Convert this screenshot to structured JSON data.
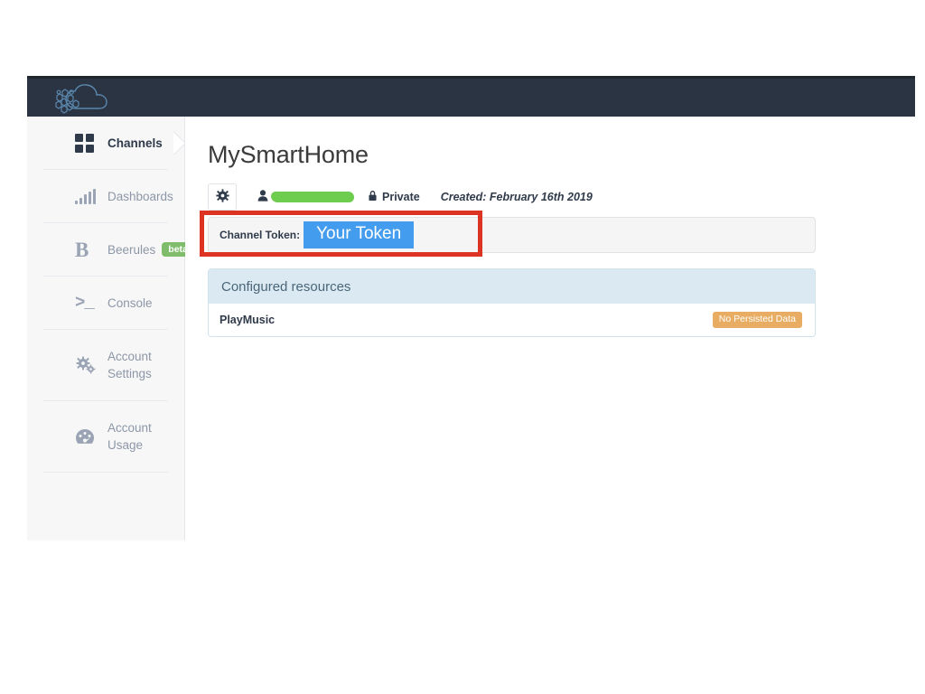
{
  "navbar": {
    "logo_name": "cloud-hexagons-logo",
    "bg_color": "#2b3443"
  },
  "sidebar": {
    "items": [
      {
        "label": "Channels",
        "icon": "grid-icon",
        "active": true,
        "badge": null
      },
      {
        "label": "Dashboards",
        "icon": "bar-chart-icon",
        "active": false,
        "badge": null
      },
      {
        "label": "Beerules",
        "icon": "letter-b-icon",
        "active": false,
        "badge": "beta"
      },
      {
        "label": "Console",
        "icon": "terminal-icon",
        "active": false,
        "badge": null
      },
      {
        "label": "Account Settings",
        "icon": "cogs-icon",
        "active": false,
        "badge": null
      },
      {
        "label": "Account Usage",
        "icon": "gauge-icon",
        "active": false,
        "badge": null
      }
    ],
    "beta_badge_color": "#7fbc6b"
  },
  "main": {
    "title": "MySmartHome",
    "meta": {
      "settings_icon": "gear-icon",
      "user_icon": "user-icon",
      "owner_redacted": "",
      "lock_icon": "lock-icon",
      "visibility": "Private",
      "created": "Created: February 16th 2019",
      "redaction_color": "#6ecd4f"
    },
    "token": {
      "label": "Channel Token:",
      "value": "Your Token",
      "highlight_color": "#439ced",
      "annotation_color": "#dd3322"
    },
    "resources": {
      "header": "Configured resources",
      "header_bg": "#dbeaf2",
      "rows": [
        {
          "name": "PlayMusic",
          "status": "No Persisted Data",
          "status_color": "#e8ad62"
        }
      ]
    }
  }
}
